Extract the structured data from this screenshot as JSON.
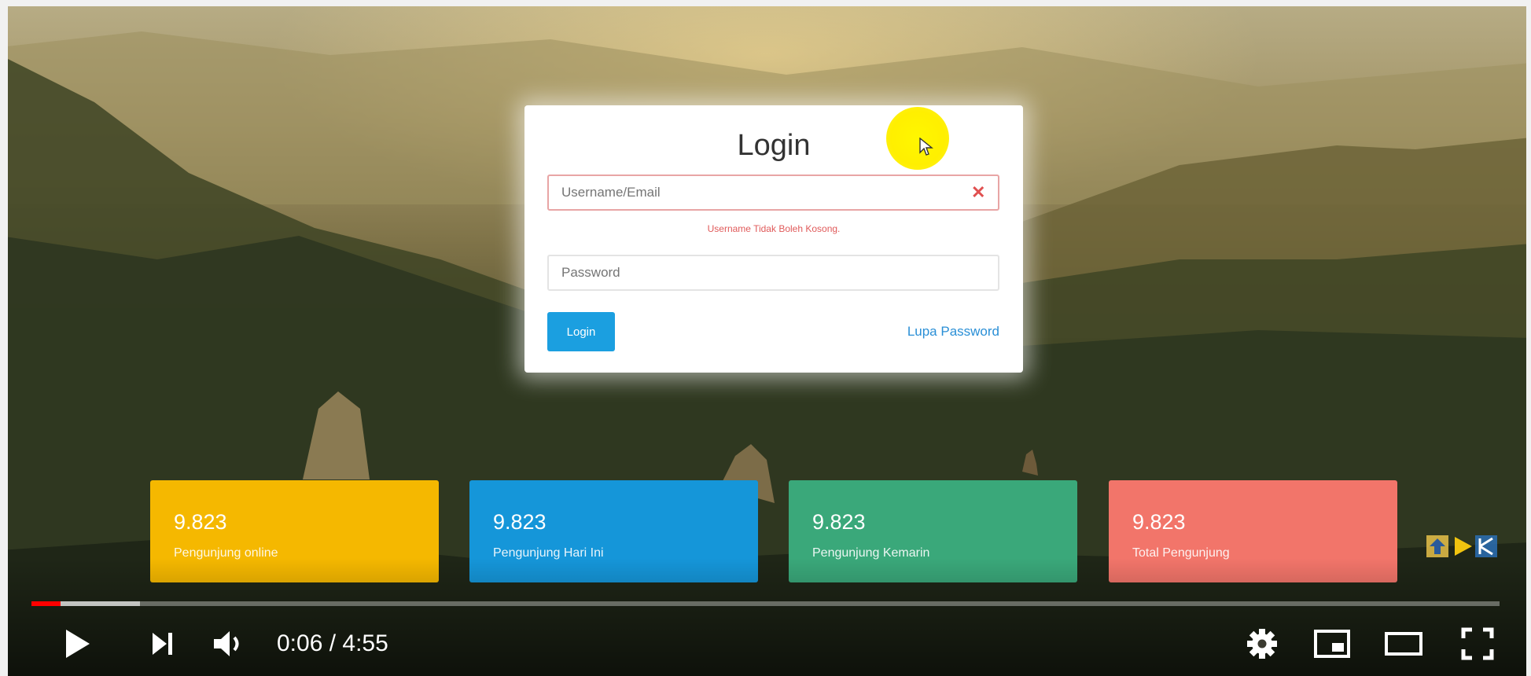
{
  "login": {
    "title": "Login",
    "username_placeholder": "Username/Email",
    "username_value": "",
    "username_error": "Username Tidak Boleh Kosong.",
    "password_placeholder": "Password",
    "password_value": "",
    "login_button": "Login",
    "forgot_link": "Lupa Password"
  },
  "stats": [
    {
      "value": "9.823",
      "label": "Pengunjung online",
      "color": "#f5b800"
    },
    {
      "value": "9.823",
      "label": "Pengunjung Hari Ini",
      "color": "#1596d9"
    },
    {
      "value": "9.823",
      "label": "Pengunjung Kemarin",
      "color": "#3aa87a"
    },
    {
      "value": "9.823",
      "label": "Total Pengunjung",
      "color": "#f2756a"
    }
  ],
  "player": {
    "time_display": "0:06 / 4:55",
    "played_fraction": 0.02,
    "buffered_fraction": 0.074,
    "accent_color": "#ff0000",
    "icons": [
      "play-icon",
      "next-icon",
      "volume-icon",
      "settings-icon",
      "miniplayer-icon",
      "theater-icon",
      "fullscreen-icon"
    ]
  }
}
